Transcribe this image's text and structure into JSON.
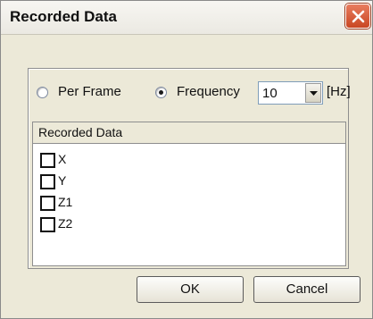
{
  "window": {
    "title": "Recorded Data"
  },
  "options": {
    "per_frame_label": "Per Frame",
    "frequency_label": "Frequency",
    "selected": "frequency",
    "frequency_value": "10",
    "unit": "[Hz]"
  },
  "list": {
    "header": "Recorded Data",
    "items": [
      {
        "label": "X",
        "checked": false
      },
      {
        "label": "Y",
        "checked": false
      },
      {
        "label": "Z1",
        "checked": false
      },
      {
        "label": "Z2",
        "checked": false
      }
    ]
  },
  "buttons": {
    "ok": "OK",
    "cancel": "Cancel"
  },
  "icons": {
    "close": "close-icon",
    "dropdown": "chevron-down-icon"
  },
  "colors": {
    "close_button": "#c94622",
    "dialog_background": "#ece9d8"
  }
}
